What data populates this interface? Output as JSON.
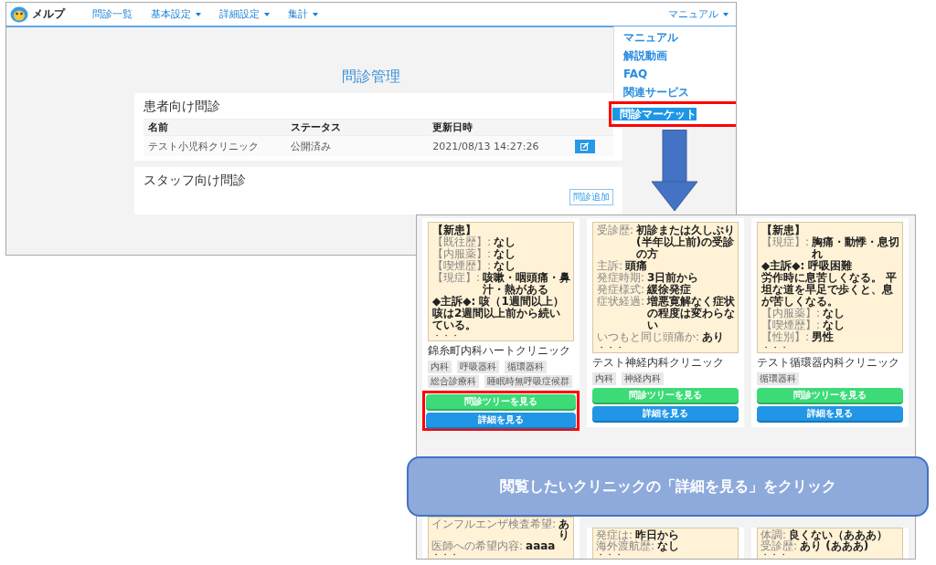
{
  "nav": {
    "brand": "メルプ",
    "items": [
      {
        "label": "問診一覧",
        "dropdown": false
      },
      {
        "label": "基本設定",
        "dropdown": true
      },
      {
        "label": "詳細設定",
        "dropdown": true
      },
      {
        "label": "集計",
        "dropdown": true
      }
    ],
    "right": {
      "label": "マニュアル",
      "dropdown": true
    }
  },
  "dropdown_menu": {
    "items": [
      {
        "label": "マニュアル",
        "highlighted": false
      },
      {
        "label": "解説動画",
        "highlighted": false
      },
      {
        "label": "FAQ",
        "highlighted": false
      },
      {
        "label": "関連サービス",
        "highlighted": false
      },
      {
        "label": "問診マーケット",
        "highlighted": true
      }
    ]
  },
  "page_title": "問診管理",
  "patient_section": {
    "title": "患者向け問診",
    "columns": [
      "名前",
      "ステータス",
      "更新日時"
    ],
    "rows": [
      {
        "cells": [
          "テスト小児科クリニック",
          "公開済み",
          "2021/08/13 14:27:26"
        ]
      }
    ]
  },
  "staff_section": {
    "title": "スタッフ向け問診",
    "add_button": "問診追加"
  },
  "market": {
    "cards": [
      {
        "lines": [
          {
            "value": "【新患】"
          },
          {
            "label": "【既往歴】:",
            "value": "なし"
          },
          {
            "label": "【内服薬】:",
            "value": "なし"
          },
          {
            "label": "【喫煙歴】:",
            "value": "なし"
          },
          {
            "label": "【現症】:",
            "value": "咳嗽・咽頭痛・鼻汁・熱がある"
          },
          {
            "value": "◆主訴◆: 咳（1週間以上）"
          },
          {
            "value": "咳は2週間以上前から続いている。"
          }
        ],
        "more": "・・・",
        "title": "錦糸町内科ハートクリニック",
        "tags": [
          "内科",
          "呼吸器科",
          "循環器科",
          "総合診療科",
          "睡眠時無呼吸症候群"
        ],
        "tree_button": "問診ツリーを見る",
        "detail_button": "詳細を見る",
        "highlighted": true
      },
      {
        "lines": [
          {
            "label": "受診歴:",
            "value": "初診または久しぶり(半年以上前)の受診の方"
          },
          {
            "label": "主訴:",
            "value": "頭痛"
          },
          {
            "label": "発症時期:",
            "value": "3日前から"
          },
          {
            "label": "発症様式:",
            "value": "緩徐発症"
          },
          {
            "label": "症状経過:",
            "value": "増悪寛解なく症状の程度は変わらない"
          },
          {
            "label": "いつもと同じ頭痛か:",
            "value": "あり"
          }
        ],
        "more": "・・・",
        "title": "テスト神経内科クリニック",
        "tags": [
          "内科",
          "神経内科"
        ],
        "tree_button": "問診ツリーを見る",
        "detail_button": "詳細を見る",
        "highlighted": false
      },
      {
        "lines": [
          {
            "value": "【新患】"
          },
          {
            "label": "【現症】:",
            "value": "胸痛・動悸・息切れ"
          },
          {
            "value": "◆主訴◆: 呼吸困難"
          },
          {
            "value": "労作時に息苦しくなる。 平坦な道を早足で歩くと、息が苦しくなる。"
          },
          {
            "label": "【内服薬】:",
            "value": "なし"
          },
          {
            "label": "【喫煙歴】:",
            "value": "なし"
          },
          {
            "label": "【性別】:",
            "value": "男性"
          }
        ],
        "more": "・・・",
        "title": "テスト循環器内科クリニック",
        "tags": [
          "循環器科"
        ],
        "tree_button": "問診ツリーを見る",
        "detail_button": "詳細を見る",
        "highlighted": false
      }
    ],
    "lower_cards": [
      {
        "lines": [
          {
            "label": "インフルエンザ検査希望:",
            "value": "あり"
          },
          {
            "label": "医師への希望内容:",
            "value": "aaaa"
          }
        ],
        "more": "・・・"
      },
      {
        "lines": [
          {
            "label": "発症は:",
            "value": "昨日から"
          },
          {
            "label": "海外渡航歴:",
            "value": "なし"
          }
        ],
        "more": "・・・"
      },
      {
        "lines": [
          {
            "label": "体調:",
            "value": "良くない（あああ）"
          },
          {
            "label": "受診歴:",
            "value": "あり (あああ)"
          }
        ],
        "more": "・・・"
      }
    ]
  },
  "callout": {
    "text": "閲覧したいクリニックの「詳細を見る」をクリック"
  }
}
